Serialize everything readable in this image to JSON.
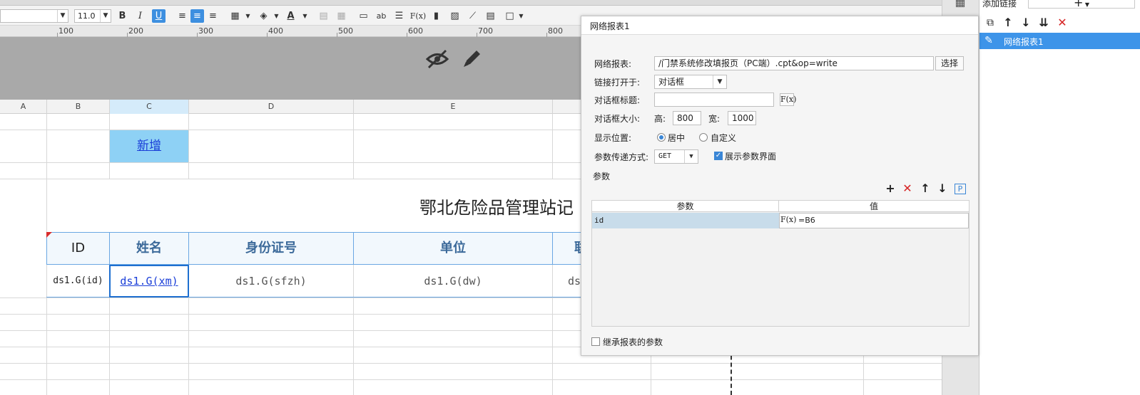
{
  "toolbar": {
    "font_size": "11.0",
    "bold": "B",
    "italic": "I",
    "underline": "U",
    "fx": "F(x)",
    "ab": "ab"
  },
  "ruler": {
    "labels": [
      "100",
      "200",
      "300",
      "400",
      "500",
      "600",
      "700",
      "800"
    ]
  },
  "sheet": {
    "columns": [
      "A",
      "B",
      "C",
      "D",
      "E"
    ],
    "add_link": "新增",
    "title_partial": "鄂北危险品管理站记",
    "headers": [
      "ID",
      "姓名",
      "身份证号",
      "单位",
      "联"
    ],
    "data": [
      "ds1.G(id)",
      "ds1.G(xm)",
      "ds1.G(sfzh)",
      "ds1.G(dw)",
      "ds"
    ]
  },
  "dialog": {
    "title": "网络报表1",
    "report_label": "网络报表:",
    "report_value": "/门禁系统修改填报页（PC端）.cpt&op=write",
    "choose_button": "选择",
    "open_in_label": "链接打开于:",
    "open_in_value": "对话框",
    "dialog_title_label": "对话框标题:",
    "dialog_title_value": "",
    "fx_label": "F(x)",
    "size_label": "对话框大小:",
    "height_label": "高:",
    "height_value": "800",
    "width_label": "宽:",
    "width_value": "1000",
    "position_label": "显示位置:",
    "position_center": "居中",
    "position_custom": "自定义",
    "param_method_label": "参数传递方式:",
    "param_method_value": "GET",
    "show_param_ui": "展示参数界面",
    "params_section": "参数",
    "param_col": "参数",
    "value_col": "值",
    "param_row_name": "id",
    "param_row_value": "=B6",
    "inherit_params": "继承报表的参数"
  },
  "right_panel": {
    "title": "添加链接",
    "add": "+",
    "item": "网络报表1"
  },
  "colors": {
    "accent": "#3a86d6",
    "selected_item": "#3d94e9",
    "header_fill": "#f2f8fd",
    "add_cell_fill": "#8ed1f5",
    "gray_area": "#a9a9a9"
  }
}
